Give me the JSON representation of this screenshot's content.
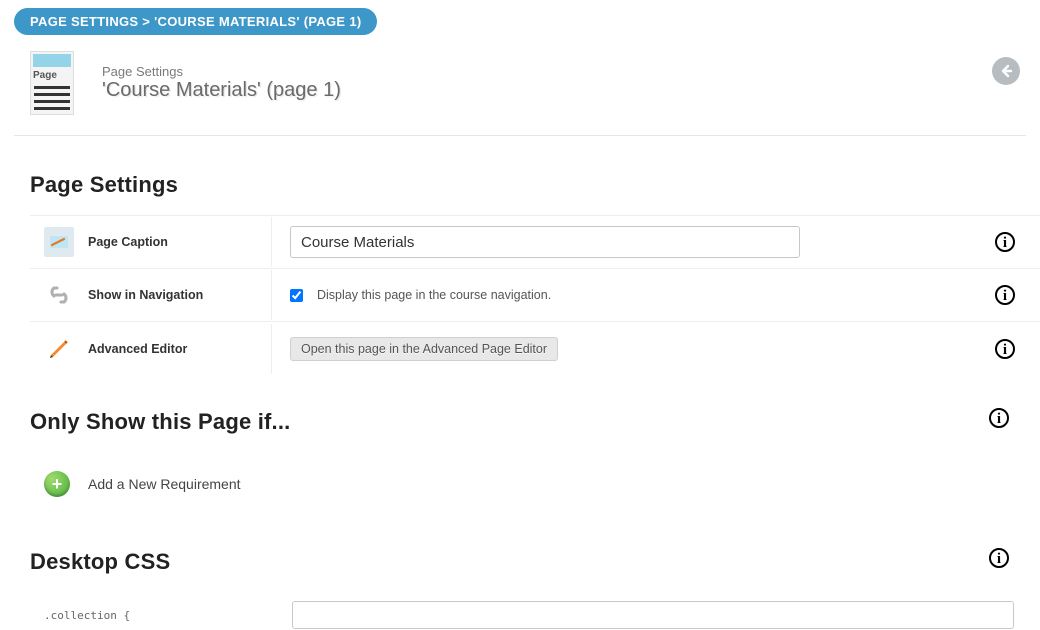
{
  "breadcrumb": "PAGE SETTINGS > 'COURSE MATERIALS' (PAGE 1)",
  "header": {
    "thumb_label": "Page",
    "subtitle": "Page Settings",
    "title": "'Course Materials' (page 1)"
  },
  "sections": {
    "page_settings": {
      "heading": "Page Settings",
      "rows": {
        "caption": {
          "label": "Page Caption",
          "value": "Course Materials"
        },
        "nav": {
          "label": "Show in Navigation",
          "checked": true,
          "text": "Display this page in the course navigation."
        },
        "adv": {
          "label": "Advanced Editor",
          "button": "Open this page in the Advanced Page Editor"
        }
      }
    },
    "conditions": {
      "heading": "Only Show this Page if...",
      "add_label": "Add a New Requirement"
    },
    "css": {
      "heading": "Desktop CSS",
      "caption_sample": ".collection {",
      "value": ""
    }
  }
}
